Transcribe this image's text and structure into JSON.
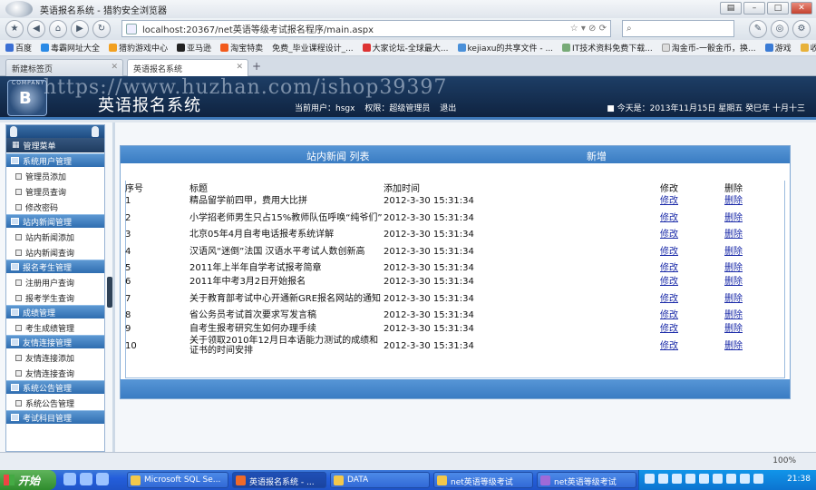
{
  "browser": {
    "title": "英语报名系统 - 猎豹安全浏览器",
    "url": "localhost:20367/net英语等级考试报名程序/main.aspx",
    "search_placeholder": "",
    "bookmarks": [
      "百度",
      "毒霸网址大全",
      "猎豹游戏中心",
      "亚马逊",
      "淘宝特卖",
      "免费_毕业课程设计_...",
      "大家论坛-全球最大...",
      "kejiaxu的共享文件 - ...",
      "IT技术资料免费下载...",
      "淘金币-一骰金币，换...",
      "游戏",
      "收藏"
    ],
    "tabs": [
      "新建标签页",
      "英语报名系统"
    ],
    "zoom": "100%"
  },
  "site": {
    "company_label": "COMPANY",
    "title": "英语报名系统",
    "watermark": "https://www.huzhan.com/ishop39397",
    "current_user_label": "当前用户：hsgx",
    "role_label": "权限：超级管理员",
    "logout_label": "退出",
    "date_text": "今天是：2013年11月15日 星期五 癸巳年 十月十三"
  },
  "sidebar": {
    "menu_title": "管理菜单",
    "groups": [
      {
        "title": "系统用户管理",
        "items": [
          "管理员添加",
          "管理员查询",
          "修改密码"
        ]
      },
      {
        "title": "站内新闻管理",
        "items": [
          "站内新闻添加",
          "站内新闻查询"
        ]
      },
      {
        "title": "报名考生管理",
        "items": [
          "注册用户查询",
          "报考学生查询"
        ]
      },
      {
        "title": "成绩管理",
        "items": [
          "考生成绩管理"
        ]
      },
      {
        "title": "友情连接管理",
        "items": [
          "友情连接添加",
          "友情连接查询"
        ]
      },
      {
        "title": "系统公告管理",
        "items": [
          "系统公告管理"
        ]
      },
      {
        "title": "考试科目管理",
        "items": []
      }
    ]
  },
  "content": {
    "list_title": "站内新闻  列表",
    "add_label": "新增",
    "columns": [
      "序号",
      "标题",
      "添加时间",
      "修改",
      "删除"
    ],
    "edit_label": "修改",
    "delete_label": "删除",
    "rows": [
      {
        "id": "1",
        "title": "精品留学前四甲，费用大比拼",
        "time": "2012-3-30 15:31:34"
      },
      {
        "id": "2",
        "title": "小学招老师男生只占15%教师队伍呼唤“纯爷们”",
        "time": "2012-3-30 15:31:34"
      },
      {
        "id": "3",
        "title": "北京05年4月自考电话报考系统详解",
        "time": "2012-3-30 15:31:34"
      },
      {
        "id": "4",
        "title": "汉语风“迷倒”法国 汉语水平考试人数创新高",
        "time": "2012-3-30 15:31:34"
      },
      {
        "id": "5",
        "title": "2011年上半年自学考试报考简章",
        "time": "2012-3-30 15:31:34"
      },
      {
        "id": "6",
        "title": "2011年中考3月2日开始报名",
        "time": "2012-3-30 15:31:34"
      },
      {
        "id": "7",
        "title": "关于教育部考试中心开通新GRE报名网站的通知",
        "time": "2012-3-30 15:31:34"
      },
      {
        "id": "8",
        "title": "省公务员考试首次要求写发言稿",
        "time": "2012-3-30 15:31:34"
      },
      {
        "id": "9",
        "title": "自考生报考研究生如何办理手续",
        "time": "2012-3-30 15:31:34"
      },
      {
        "id": "10",
        "title": "关于领取2010年12月日本语能力测试的成绩和证书的时间安排",
        "time": "2012-3-30 15:31:34"
      }
    ]
  },
  "taskbar": {
    "start_label": "开始",
    "tasks": [
      "Microsoft SQL Se...",
      "英语报名系统 - ...",
      "DATA",
      "net英语等级考试",
      "net英语等级考试"
    ],
    "clock": "21:38"
  }
}
